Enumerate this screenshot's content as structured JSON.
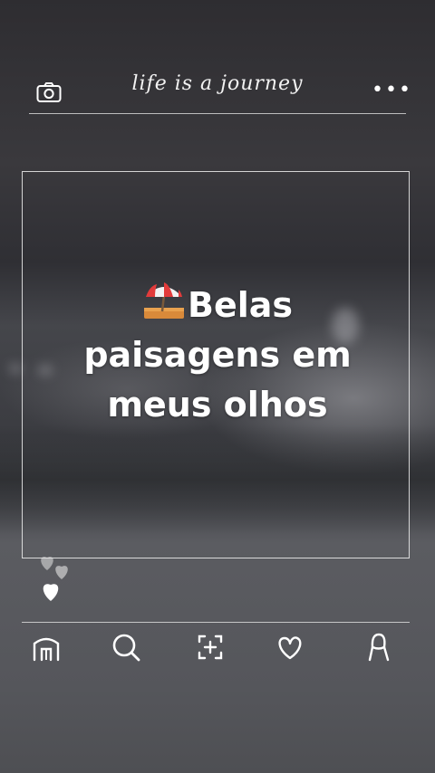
{
  "header": {
    "title": "life is a journey",
    "camera_icon": "camera-icon",
    "more_icon": "more-horizontal-icon",
    "more_label": "•••"
  },
  "post": {
    "caption_line1": "Belas",
    "caption_line2": "paisagens em",
    "caption_line3": "meus olhos",
    "emoji_icon": "beach-umbrella-icon"
  },
  "reactions": {
    "icon": "floating-hearts-icon"
  },
  "bottom_nav": {
    "items": [
      {
        "icon": "home-icon"
      },
      {
        "icon": "search-icon"
      },
      {
        "icon": "add-post-icon"
      },
      {
        "icon": "heart-icon"
      },
      {
        "icon": "profile-icon"
      }
    ]
  },
  "colors": {
    "line": "#ebebeb",
    "text": "#ffffff"
  }
}
